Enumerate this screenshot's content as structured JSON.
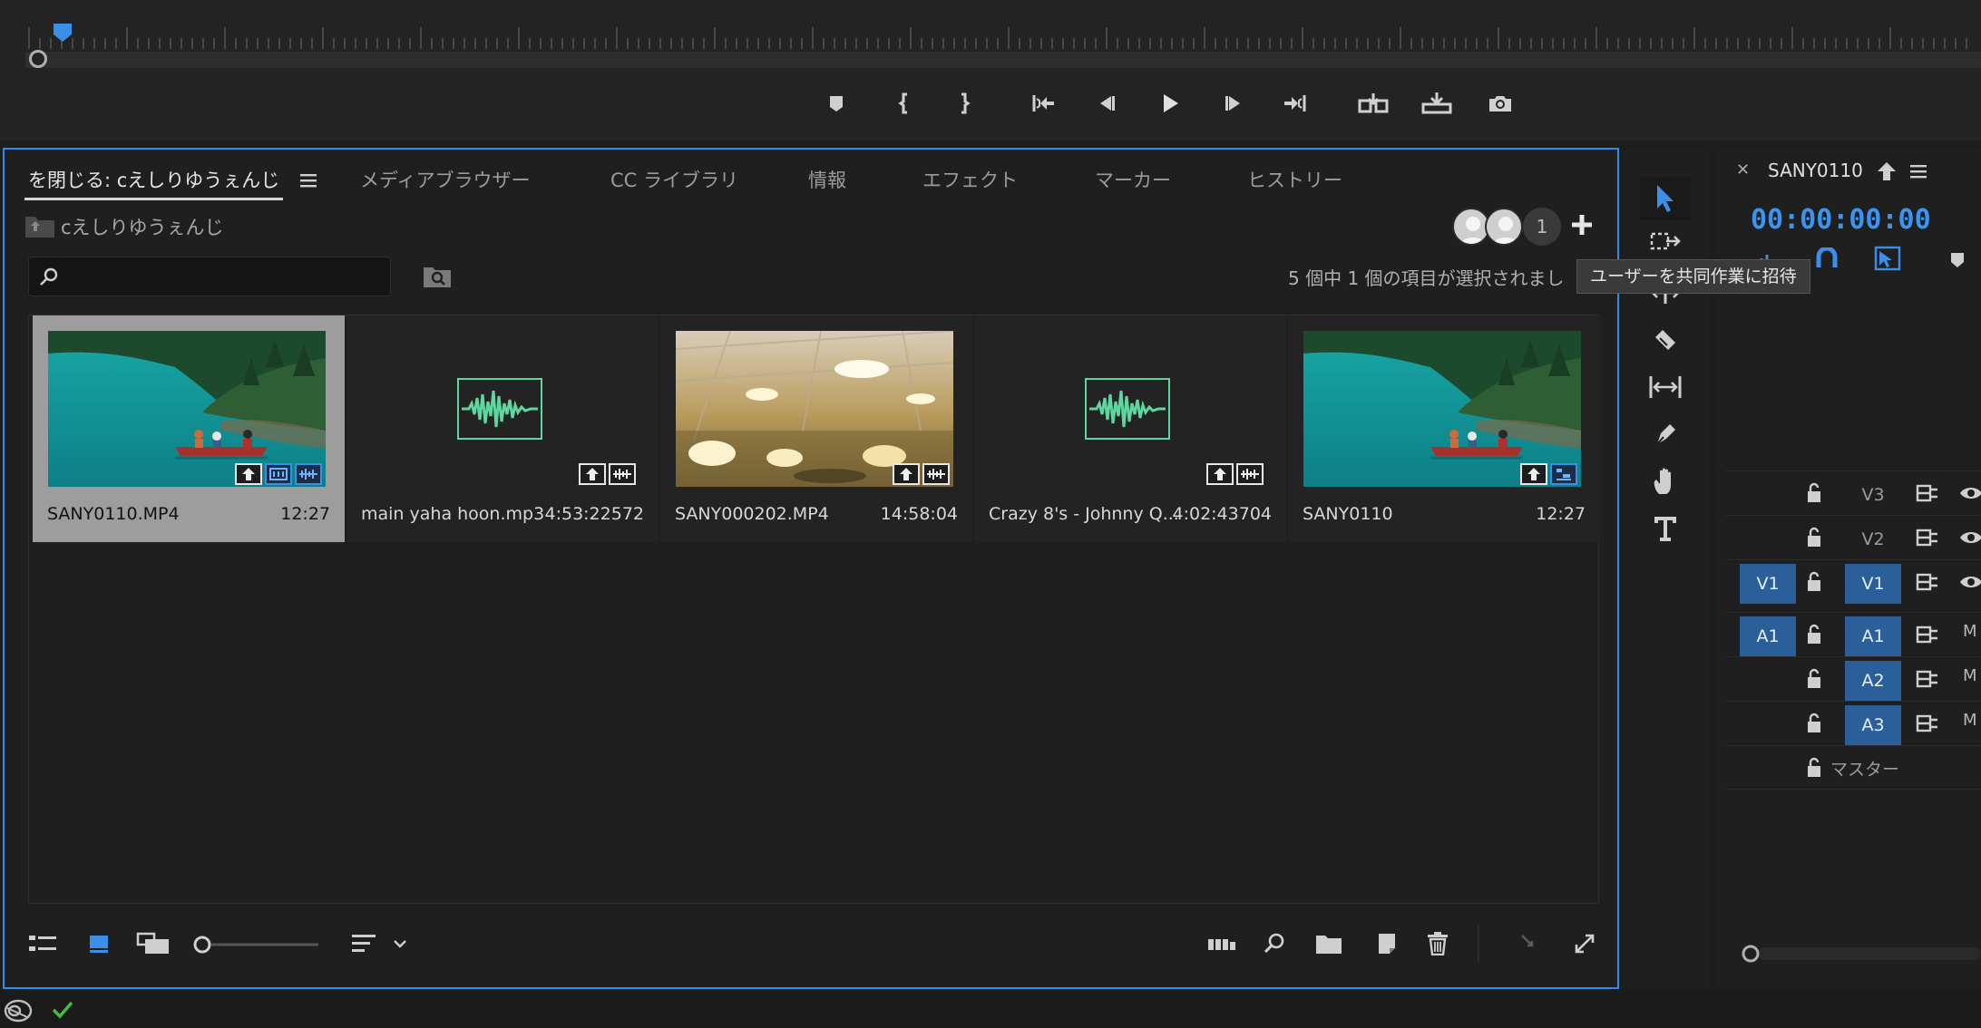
{
  "project_panel": {
    "tabs": [
      {
        "label": "を閉じる: cえしりゆうぇんじ",
        "active": true
      },
      {
        "label": "メディアブラウザー"
      },
      {
        "label": "CC ライブラリ"
      },
      {
        "label": "情報"
      },
      {
        "label": "エフェクト"
      },
      {
        "label": "マーカー"
      },
      {
        "label": "ヒストリー"
      }
    ],
    "bin_name": "cえしりゆうぇんじ",
    "collaborators_count": "1",
    "search_placeholder": "",
    "selection_status": "5 個中 1 個の項目が選択されまし",
    "tooltip": "ユーザーを共同作業に招待",
    "items": [
      {
        "name": "SANY0110.MP4",
        "duration": "12:27",
        "kind": "video-lake",
        "selected": true
      },
      {
        "name": "main yaha hoon.mp3",
        "duration": "4:53:22572",
        "kind": "audio"
      },
      {
        "name": "SANY000202.MP4",
        "duration": "14:58:04",
        "kind": "video-ceiling"
      },
      {
        "name": "Crazy 8's - Johnny Q...",
        "duration": "4:02:43704",
        "kind": "audio"
      },
      {
        "name": "SANY0110",
        "duration": "12:27",
        "kind": "sequence-lake"
      }
    ]
  },
  "timeline_panel": {
    "sequence_title": "SANY0110",
    "timecode": "00:00:00:00",
    "tracks": [
      {
        "label": "V3",
        "type": "video"
      },
      {
        "label": "V2",
        "type": "video"
      },
      {
        "label": "V1",
        "type": "video",
        "source_patch": "V1",
        "targeted": true
      },
      {
        "label": "A1",
        "type": "audio",
        "source_patch": "A1",
        "targeted": true,
        "mute": "M"
      },
      {
        "label": "A2",
        "type": "audio",
        "targeted": true,
        "mute": "M"
      },
      {
        "label": "A3",
        "type": "audio",
        "targeted": true,
        "mute": "M"
      },
      {
        "label": "マスター",
        "type": "master"
      }
    ]
  },
  "colors": {
    "accent": "#2d8ceb",
    "timecode": "#3d93f0",
    "waveform": "#5fd5a0",
    "track_patch": "#2a5f9a",
    "status_check": "#3fbf3f"
  }
}
